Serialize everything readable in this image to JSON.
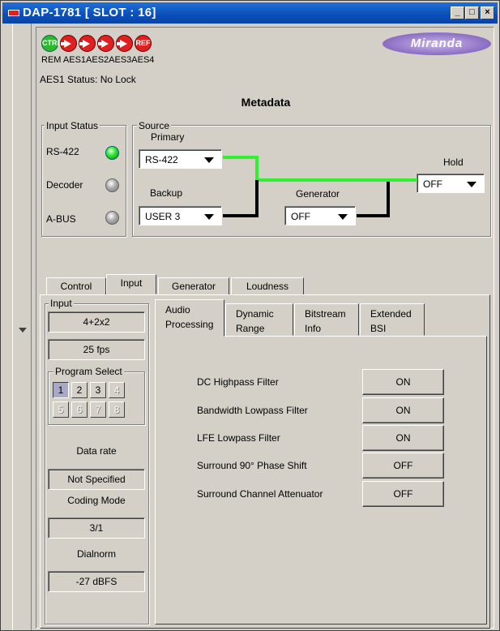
{
  "window": {
    "title": "DAP-1781 [ SLOT : 16]",
    "minimize": "_",
    "maximize": "□",
    "close": "×"
  },
  "header": {
    "indicators": [
      {
        "label": "CTRL",
        "color": "#2fb82f"
      },
      {
        "label": "",
        "color": "#e02020"
      },
      {
        "label": "",
        "color": "#e02020"
      },
      {
        "label": "",
        "color": "#e02020"
      },
      {
        "label": "",
        "color": "#e02020"
      },
      {
        "label": "REF",
        "color": "#e02020"
      }
    ],
    "indicator_labels": "REM AES1AES2AES3AES4",
    "logo": "Miranda"
  },
  "status_text": "AES1 Status: No Lock",
  "page_title": "Metadata",
  "input_status": {
    "legend": "Input Status",
    "items": [
      {
        "label": "RS-422",
        "state": "on"
      },
      {
        "label": "Decoder",
        "state": "off"
      },
      {
        "label": "A-BUS",
        "state": "off"
      }
    ]
  },
  "source": {
    "legend": "Source",
    "primary_label": "Primary",
    "primary_value": "RS-422",
    "backup_label": "Backup",
    "backup_value": "USER 3",
    "generator_label": "Generator",
    "generator_value": "OFF",
    "hold_label": "Hold",
    "hold_value": "OFF"
  },
  "tabs": [
    "Control",
    "Input",
    "Generator",
    "Loudness"
  ],
  "active_tab": "Input",
  "input_panel": {
    "legend": "Input",
    "channels": "4+2x2",
    "frame_rate": "25 fps",
    "program_select_legend": "Program Select",
    "programs": [
      "1",
      "2",
      "3",
      "4",
      "5",
      "6",
      "7",
      "8"
    ],
    "data_rate_label": "Data rate",
    "data_rate_value": "Not Specified",
    "coding_mode_label": "Coding Mode",
    "coding_mode_value": "3/1",
    "dialnorm_label": "Dialnorm",
    "dialnorm_value": "-27 dBFS"
  },
  "subtabs": [
    {
      "line1": "Audio",
      "line2": "Processing"
    },
    {
      "line1": "Dynamic",
      "line2": "Range"
    },
    {
      "line1": "Bitstream",
      "line2": "Info"
    },
    {
      "line1": "Extended",
      "line2": "BSI"
    }
  ],
  "processing": [
    {
      "label": "DC Highpass Filter",
      "value": "ON"
    },
    {
      "label": "Bandwidth Lowpass Filter",
      "value": "ON"
    },
    {
      "label": "LFE Lowpass Filter",
      "value": "ON"
    },
    {
      "label": "Surround 90° Phase Shift",
      "value": "OFF"
    },
    {
      "label": "Surround Channel Attenuator",
      "value": "OFF"
    }
  ]
}
